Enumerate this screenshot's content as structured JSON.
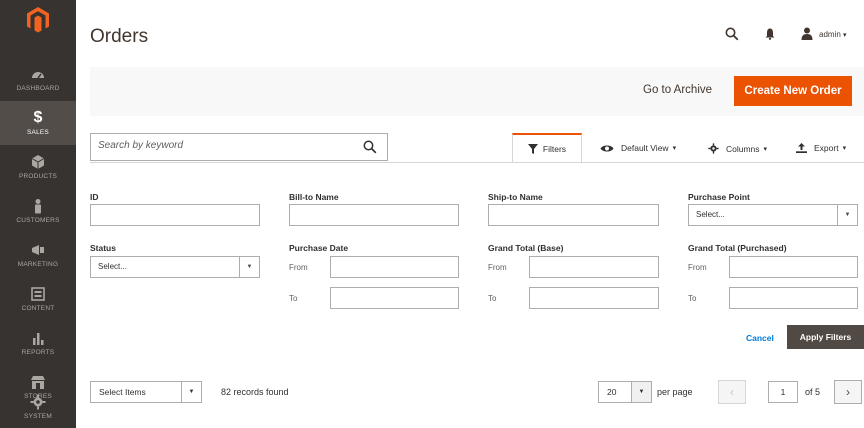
{
  "sidebar": {
    "items": [
      {
        "label": "Dashboard",
        "icon": "dashboard-icon"
      },
      {
        "label": "Sales",
        "icon": "dollar-icon",
        "active": true
      },
      {
        "label": "Products",
        "icon": "cube-icon"
      },
      {
        "label": "Customers",
        "icon": "person-icon"
      },
      {
        "label": "Marketing",
        "icon": "megaphone-icon"
      },
      {
        "label": "Content",
        "icon": "layout-icon"
      },
      {
        "label": "Reports",
        "icon": "bar-chart-icon"
      },
      {
        "label": "Stores",
        "icon": "storefront-icon"
      },
      {
        "label": "System",
        "icon": "gear-icon"
      }
    ]
  },
  "header": {
    "title": "Orders",
    "user": "admin"
  },
  "actions": {
    "archive": "Go to Archive",
    "create": "Create New Order"
  },
  "search": {
    "placeholder": "Search by keyword"
  },
  "toolbar": {
    "filters": "Filters",
    "view": "Default View",
    "columns": "Columns",
    "export": "Export"
  },
  "filters": {
    "id_label": "ID",
    "bill_to_label": "Bill-to Name",
    "ship_to_label": "Ship-to Name",
    "purchase_point_label": "Purchase Point",
    "purchase_point_value": "Select...",
    "status_label": "Status",
    "status_value": "Select...",
    "purchase_date_label": "Purchase Date",
    "grand_total_base_label": "Grand Total (Base)",
    "grand_total_purchased_label": "Grand Total (Purchased)",
    "from_label": "From",
    "to_label": "To",
    "cancel": "Cancel",
    "apply": "Apply Filters"
  },
  "grid_footer": {
    "mass_select": "Select Items",
    "records_found": "82 records found",
    "per_page_value": "20",
    "per_page_label": "per page",
    "current_page": "1",
    "total_pages": "of 5"
  },
  "colors": {
    "sidebar_bg": "#373330",
    "accent": "#eb5202",
    "apply_bg": "#514943",
    "link": "#007bdb"
  }
}
